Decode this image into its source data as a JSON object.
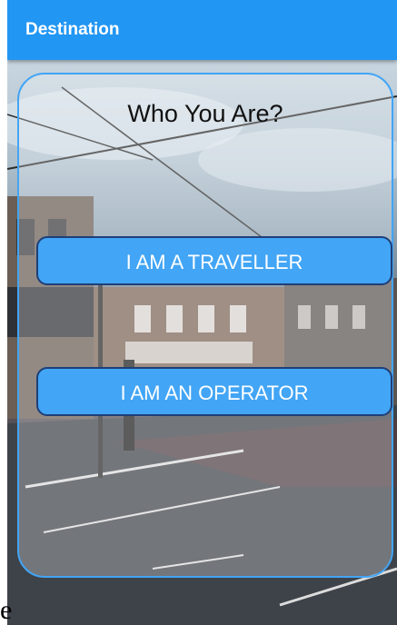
{
  "app_bar": {
    "title": "Destination"
  },
  "card": {
    "title": "Who You Are?",
    "buttons": [
      {
        "label": "I AM A TRAVELLER"
      },
      {
        "label": "I AM AN OPERATOR"
      }
    ]
  },
  "stray_text": "e",
  "colors": {
    "app_bar": "#2196f3",
    "button": "#42a5f5",
    "button_border": "#1f3f78",
    "card_border": "#42a5f5"
  }
}
